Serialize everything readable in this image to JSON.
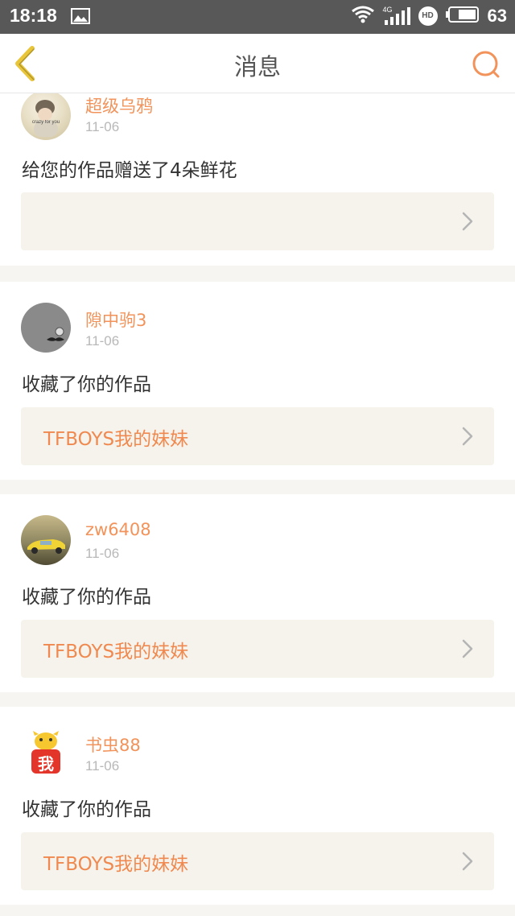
{
  "status": {
    "time": "18:18",
    "network": "4G",
    "hd": "HD",
    "battery": "63"
  },
  "nav": {
    "title": "消息",
    "back_icon": "chevron-left-icon",
    "search_icon": "search-icon"
  },
  "colors": {
    "accent": "#f1935a",
    "back_icon": "#e9c53a",
    "work_box_bg": "#f5f3ec"
  },
  "messages": [
    {
      "username": "超级乌鸦",
      "date": "11-06",
      "action": "给您的作品赠送了4朵鲜花",
      "work_title": "",
      "avatar_caption": "crazy for you"
    },
    {
      "username": "隙中驹3",
      "date": "11-06",
      "action": "收藏了你的作品",
      "work_title": "TFBOYS我的妹妹"
    },
    {
      "username": "zw6408",
      "date": "11-06",
      "action": "收藏了你的作品",
      "work_title": "TFBOYS我的妹妹"
    },
    {
      "username": "书虫88",
      "date": "11-06",
      "action": "收藏了你的作品",
      "work_title": "TFBOYS我的妹妹",
      "avatar_badge": "我"
    }
  ]
}
